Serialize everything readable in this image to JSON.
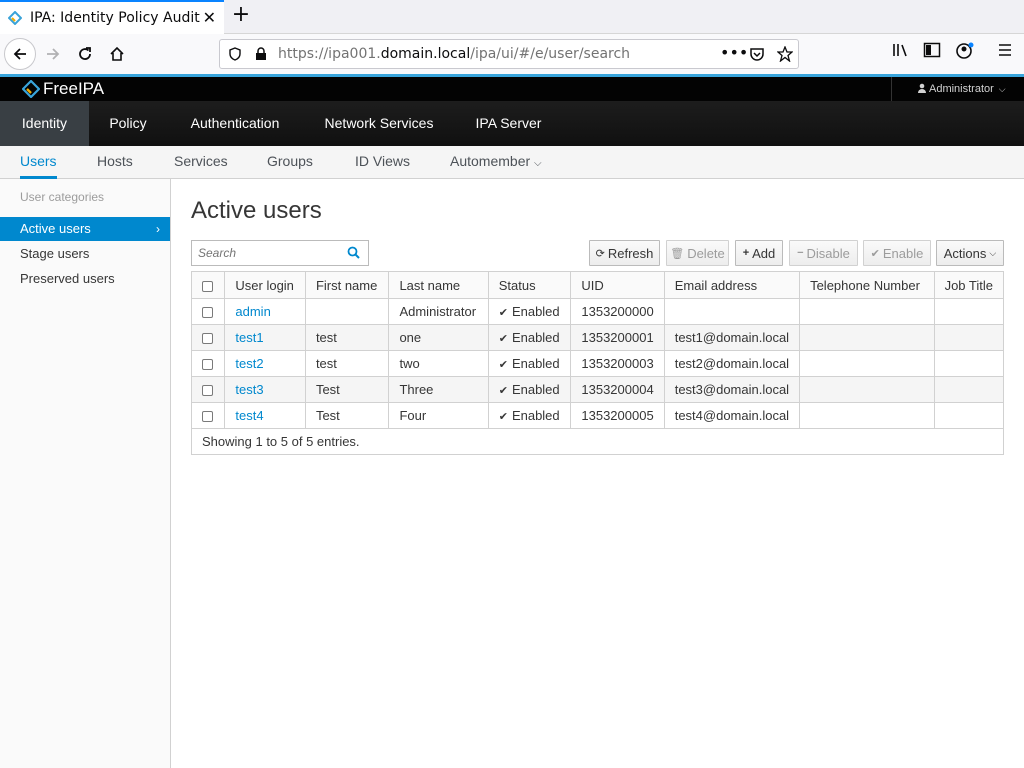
{
  "browser": {
    "tab_title": "IPA: Identity Policy Audit",
    "url_prefix": "https://ipa001.",
    "url_host": "domain.local",
    "url_path": "/ipa/ui/#/e/user/search"
  },
  "app": {
    "brand": "FreeIPA",
    "user_menu": "Administrator"
  },
  "primary_nav": [
    "Identity",
    "Policy",
    "Authentication",
    "Network Services",
    "IPA Server"
  ],
  "secondary_nav": [
    "Users",
    "Hosts",
    "Services",
    "Groups",
    "ID Views",
    "Automember"
  ],
  "sidebar": {
    "category": "User categories",
    "items": [
      "Active users",
      "Stage users",
      "Preserved users"
    ]
  },
  "main": {
    "title": "Active users",
    "search_placeholder": "Search",
    "buttons": {
      "refresh": "Refresh",
      "delete": "Delete",
      "add": "Add",
      "disable": "Disable",
      "enable": "Enable",
      "actions": "Actions"
    },
    "columns": [
      "User login",
      "First name",
      "Last name",
      "Status",
      "UID",
      "Email address",
      "Telephone Number",
      "Job Title"
    ],
    "rows": [
      {
        "login": "admin",
        "first": "",
        "last": "Administrator",
        "status": "Enabled",
        "uid": "1353200000",
        "email": "",
        "phone": "",
        "job": ""
      },
      {
        "login": "test1",
        "first": "test",
        "last": "one",
        "status": "Enabled",
        "uid": "1353200001",
        "email": "test1@domain.local",
        "phone": "",
        "job": ""
      },
      {
        "login": "test2",
        "first": "test",
        "last": "two",
        "status": "Enabled",
        "uid": "1353200003",
        "email": "test2@domain.local",
        "phone": "",
        "job": ""
      },
      {
        "login": "test3",
        "first": "Test",
        "last": "Three",
        "status": "Enabled",
        "uid": "1353200004",
        "email": "test3@domain.local",
        "phone": "",
        "job": ""
      },
      {
        "login": "test4",
        "first": "Test",
        "last": "Four",
        "status": "Enabled",
        "uid": "1353200005",
        "email": "test4@domain.local",
        "phone": "",
        "job": ""
      }
    ],
    "footer": "Showing 1 to 5 of 5 entries."
  },
  "colors": {
    "accent": "#0088ce",
    "header_bg": "#030303",
    "nav_active": "#393f44"
  }
}
